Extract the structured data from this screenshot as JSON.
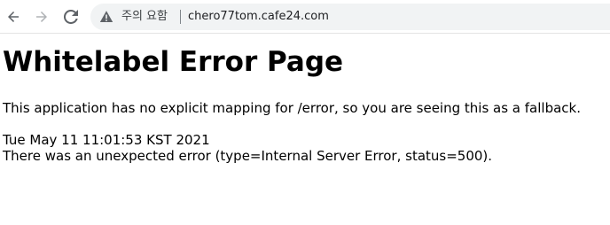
{
  "browser": {
    "security_label": "주의 요함",
    "url": "chero77tom.cafe24.com",
    "icons": {
      "back": "back-arrow-icon",
      "forward": "forward-arrow-icon",
      "reload": "reload-icon",
      "security": "warning-icon"
    }
  },
  "page": {
    "title": "Whitelabel Error Page",
    "explanation": "This application has no explicit mapping for /error, so you are seeing this as a fallback.",
    "timestamp": "Tue May 11 11:01:53 KST 2021",
    "error_message": "There was an unexpected error (type=Internal Server Error, status=500)."
  }
}
